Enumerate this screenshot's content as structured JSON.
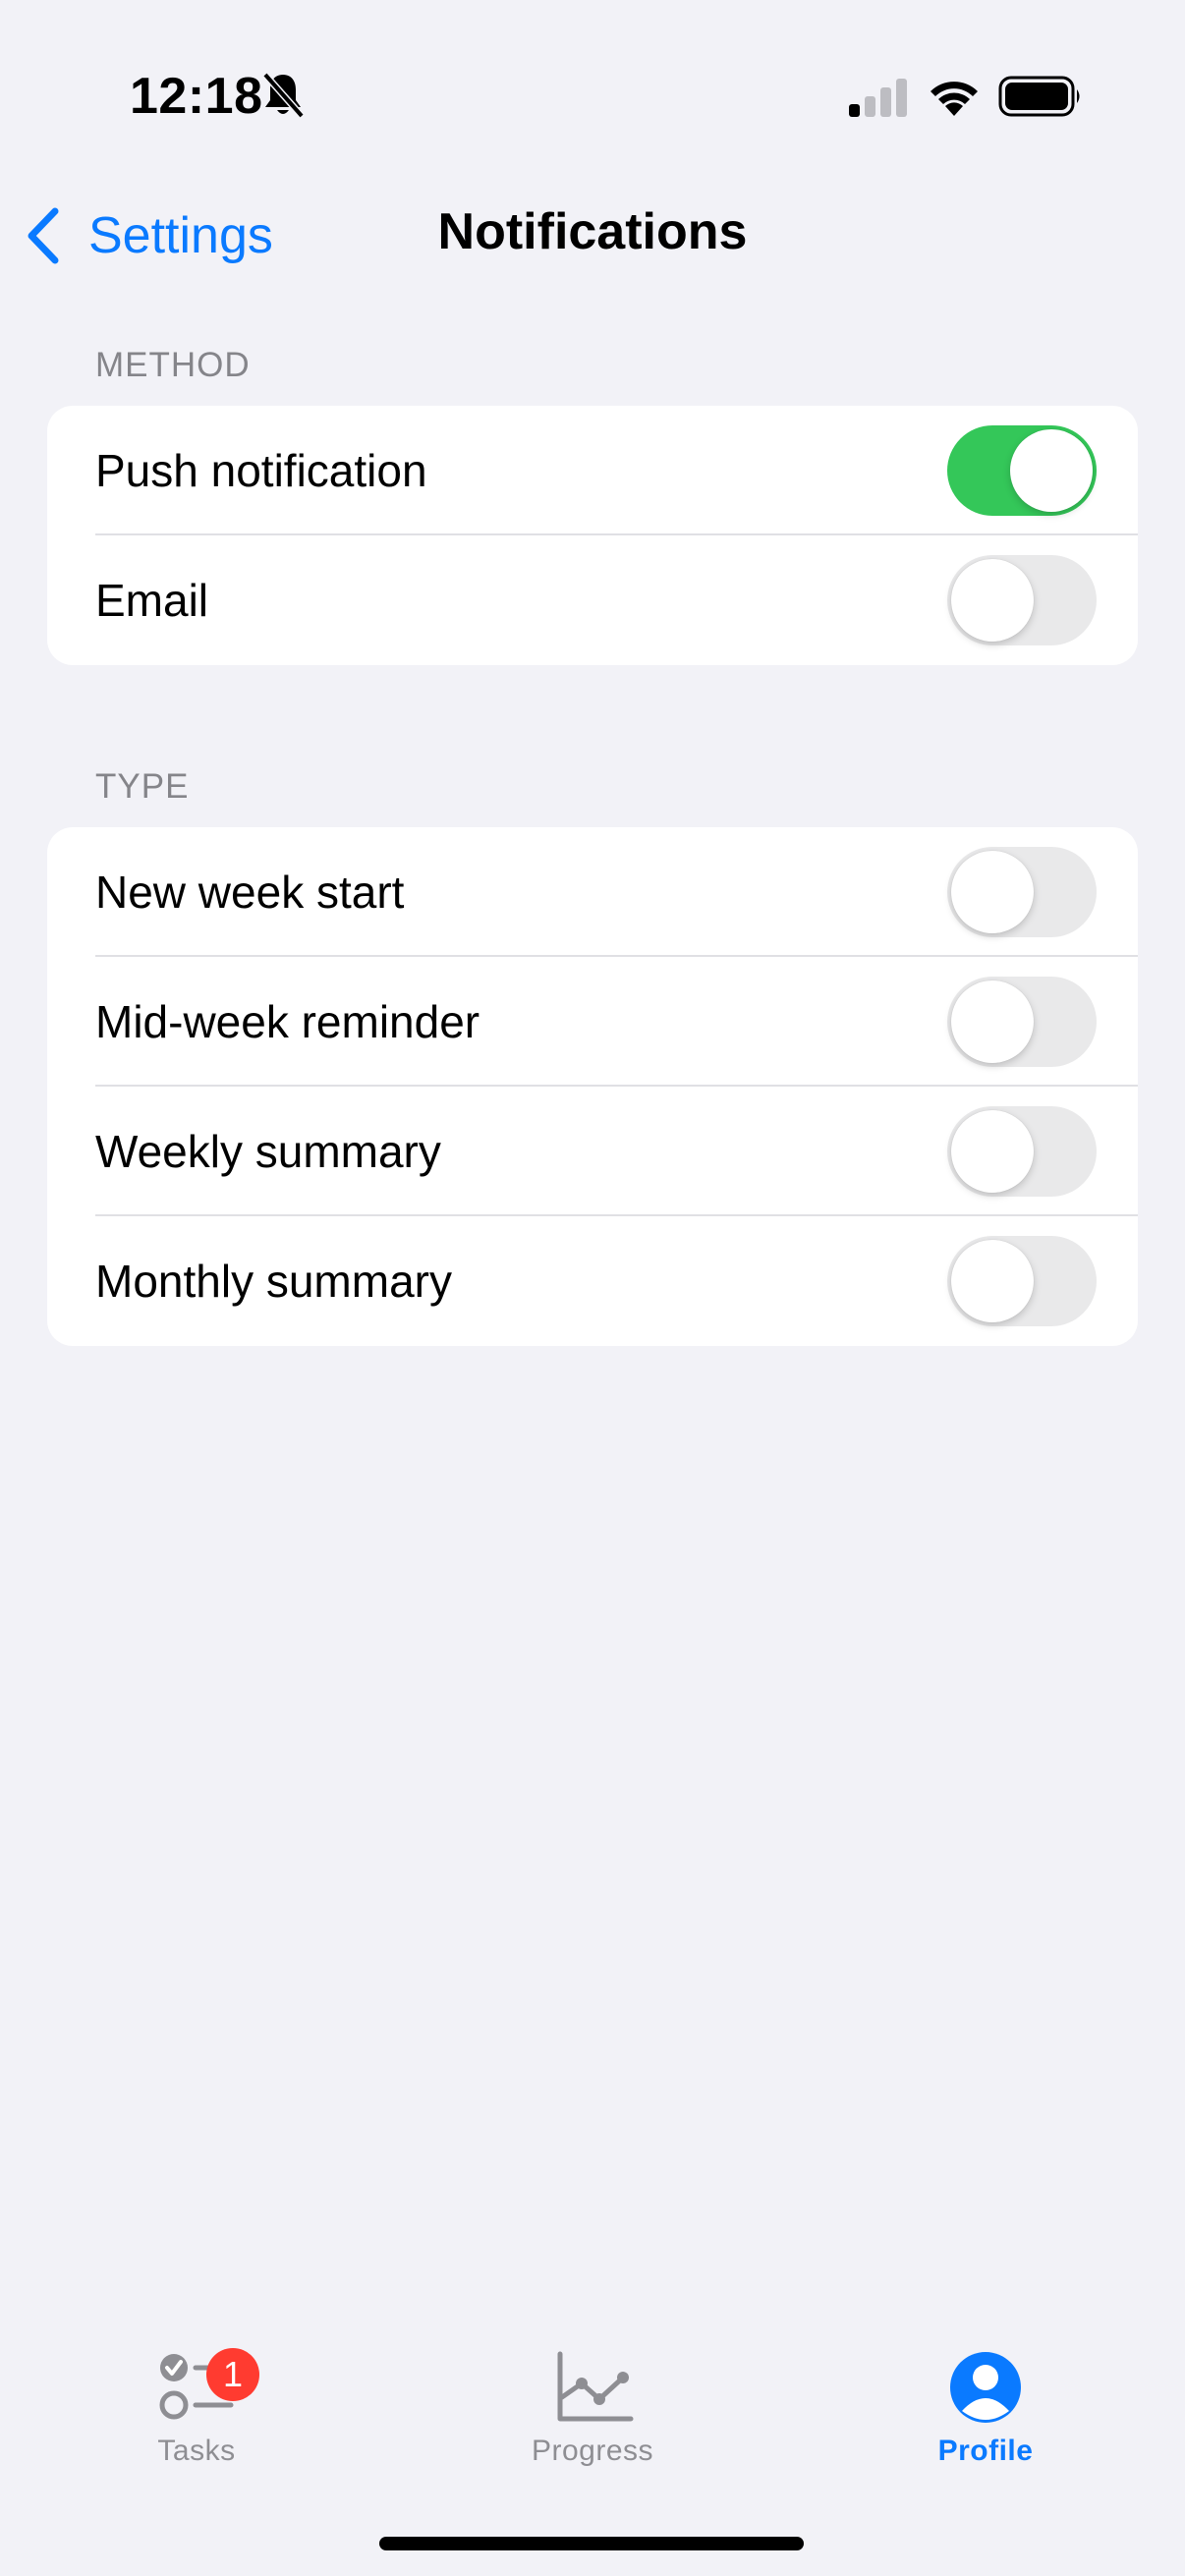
{
  "status_bar": {
    "time": "12:18",
    "icons": [
      "bell-slash-icon",
      "cellular-signal-icon",
      "wifi-icon",
      "battery-icon"
    ]
  },
  "nav": {
    "back_label": "Settings",
    "title": "Notifications"
  },
  "sections": {
    "method": {
      "header": "METHOD",
      "items": [
        {
          "label": "Push notification",
          "enabled": true
        },
        {
          "label": "Email",
          "enabled": false
        }
      ]
    },
    "type": {
      "header": "TYPE",
      "items": [
        {
          "label": "New week start",
          "enabled": false
        },
        {
          "label": "Mid-week reminder",
          "enabled": false
        },
        {
          "label": "Weekly summary",
          "enabled": false
        },
        {
          "label": "Monthly summary",
          "enabled": false
        }
      ]
    }
  },
  "tab_bar": {
    "tabs": [
      {
        "label": "Tasks",
        "icon": "checklist-icon",
        "badge": "1"
      },
      {
        "label": "Progress",
        "icon": "line-chart-icon"
      },
      {
        "label": "Profile",
        "icon": "person-circle-icon",
        "active": true
      }
    ]
  },
  "colors": {
    "accent": "#0A7AFF",
    "toggle_on": "#34C759",
    "toggle_off": "#E9E9EA",
    "background": "#F2F2F7",
    "badge": "#FF3B30"
  }
}
